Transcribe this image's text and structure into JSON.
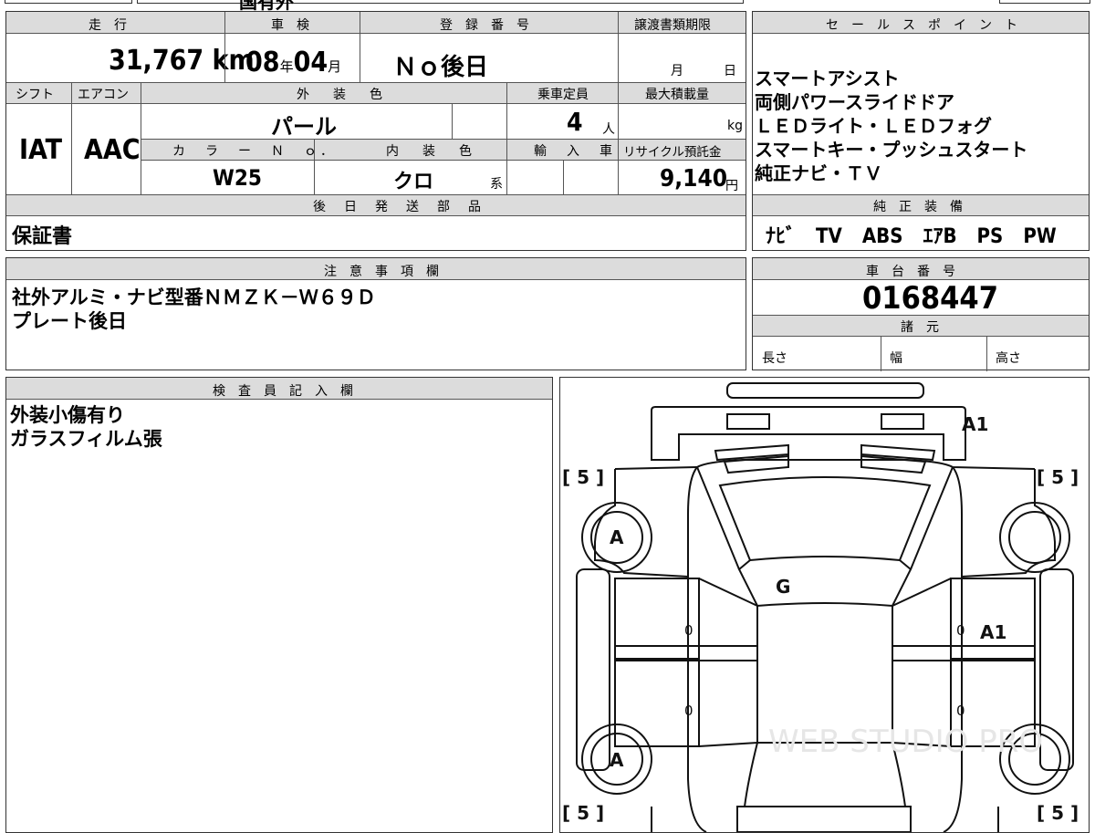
{
  "top_strip": {
    "visible_fragment": "国有外"
  },
  "headers": {
    "mileage": "走　行",
    "inspection": "車　検",
    "registration": "登　録　番　号",
    "transfer_deadline": "譲渡書類期限",
    "shift": "シフト",
    "aircon": "エアコン",
    "exterior_color": "外　装　色",
    "capacity": "乗車定員",
    "max_load": "最大積載量",
    "color_no": "カ　ラ　ー　Ｎ　ｏ．",
    "interior_color": "内　装　色",
    "import": "輸　入　車",
    "recycle_fee": "リサイクル預託金",
    "later_parts": "後　日　発　送　部　品",
    "sales_point": "セ　ー　ル　ス　ポ　イ　ン　ト",
    "genuine_equipment": "純　正　装　備",
    "notes": "注　意　事　項　欄",
    "chassis_number": "車　台　番　号",
    "specs": "諸　元",
    "inspector": "検　査　員　記　入　欄"
  },
  "vehicle": {
    "mileage": "31,767",
    "mileage_unit": "km",
    "inspection_year": "08",
    "year_unit": "年",
    "inspection_month": "04",
    "month_unit": "月",
    "registration": "Ｎｏ後日",
    "transfer_month_unit": "月",
    "transfer_day_unit": "日",
    "shift": "IAT",
    "aircon": "AAC",
    "exterior_color": "パール",
    "capacity": "4",
    "capacity_unit": "人",
    "max_load_unit": "kg",
    "color_no": "W25",
    "interior_color": "クロ",
    "interior_suffix": "系",
    "recycle_fee": "9,140",
    "recycle_unit": "円",
    "later_parts": "保証書",
    "chassis_number": "0168447"
  },
  "sales_points": [
    "スマートアシスト",
    "両側パワースライドドア",
    "ＬＥＤライト・ＬＥＤフォグ",
    "スマートキー・プッシュスタート",
    "純正ナビ・ＴＶ"
  ],
  "genuine_equipment": "ﾅﾋﾞ　TV　ABS　ｴｱB　PS　PW",
  "notes": [
    "社外アルミ・ナビ型番ＮＭＺＫ－Ｗ６９Ｄ",
    "プレート後日"
  ],
  "specs": {
    "length": "長さ",
    "width": "幅",
    "height": "高さ"
  },
  "inspector_notes": [
    "外装小傷有り",
    "ガラスフィルム張"
  ],
  "diagram": {
    "tire_labels": [
      "[ 5 ]",
      "[ 5 ]",
      "[ 5 ]",
      "[ 5 ]"
    ],
    "marks": {
      "front_bumper": "A1",
      "front_left_wheel": "A",
      "rear_left_wheel": "A",
      "windshield": "G",
      "right_front_door": "A1",
      "left_front_door_zero": "0",
      "left_rear_door_zero": "0",
      "right_front_door_zero": "0",
      "right_rear_door_zero": "0"
    },
    "watermark": "WEB STUDIO PRO"
  }
}
